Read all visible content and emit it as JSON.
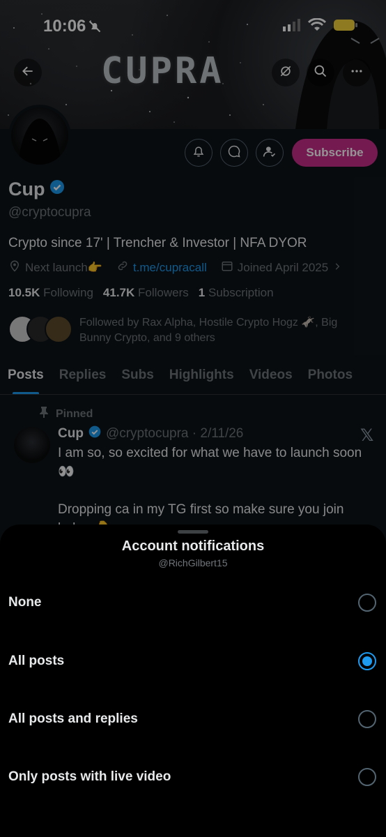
{
  "status_bar": {
    "time": "10:06"
  },
  "banner": {
    "title": "CUPRA"
  },
  "profile": {
    "display_name": "Cup",
    "handle": "@cryptocupra",
    "bio": "Crypto since 17' | Trencher & Investor | NFA DYOR",
    "location": "Next launch👉",
    "link": "t.me/cupracall",
    "joined": "Joined April 2025",
    "following_count": "10.5K",
    "following_label": "Following",
    "followers_count": "41.7K",
    "followers_label": "Followers",
    "subscription_count": "1",
    "subscription_label": "Subscription",
    "followed_by": "Followed by Rax Alpha, Hostile Crypto Hogz 🫏, Big Bunny Crypto, and 9 others",
    "subscribe_label": "Subscribe"
  },
  "tabs": [
    "Posts",
    "Replies",
    "Subs",
    "Highlights",
    "Videos",
    "Photos"
  ],
  "active_tab": "Posts",
  "pinned_post": {
    "pinned_label": "Pinned",
    "author": "Cup",
    "handle_date": "@cryptocupra · 2/11/26",
    "text_line1": "I am so, so excited for what we have to launch soon👀",
    "text_line2": "Dropping ca in my TG first so make sure you join below 👇"
  },
  "sheet": {
    "title": "Account notifications",
    "subtitle": "@RichGilbert15",
    "options": [
      {
        "label": "None",
        "selected": false
      },
      {
        "label": "All posts",
        "selected": true
      },
      {
        "label": "All posts and replies",
        "selected": false
      },
      {
        "label": "Only posts with live video",
        "selected": false
      }
    ]
  },
  "colors": {
    "accent": "#1d9bf0",
    "subscribe": "#c92d8c",
    "background": "#0f1419",
    "sheet": "#000000"
  }
}
